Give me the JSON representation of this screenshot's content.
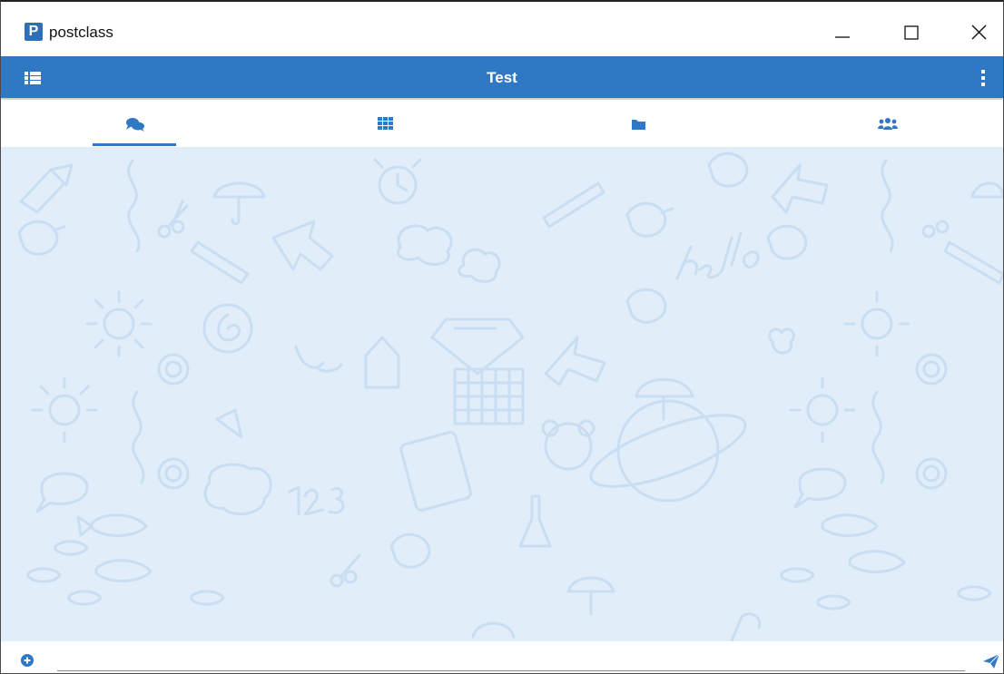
{
  "window": {
    "app_name": "postclass",
    "logo_letter": "P",
    "controls": {
      "minimize": "minimize-icon",
      "maximize": "maximize-icon",
      "close": "close-icon"
    }
  },
  "header": {
    "title": "Test",
    "menu_icon": "list-menu-icon",
    "more_icon": "more-vertical-icon",
    "color": "#2f78c4"
  },
  "tabs": [
    {
      "icon": "chat-bubbles-icon",
      "selected": true
    },
    {
      "icon": "apps-grid-icon",
      "selected": false
    },
    {
      "icon": "folder-icon",
      "selected": false
    },
    {
      "icon": "users-group-icon",
      "selected": false
    }
  ],
  "chat": {
    "background": "#e1eef9",
    "messages": []
  },
  "composer": {
    "attach_icon": "plus-circle-icon",
    "input_value": "",
    "input_hint": "...",
    "send_icon": "send-icon"
  }
}
